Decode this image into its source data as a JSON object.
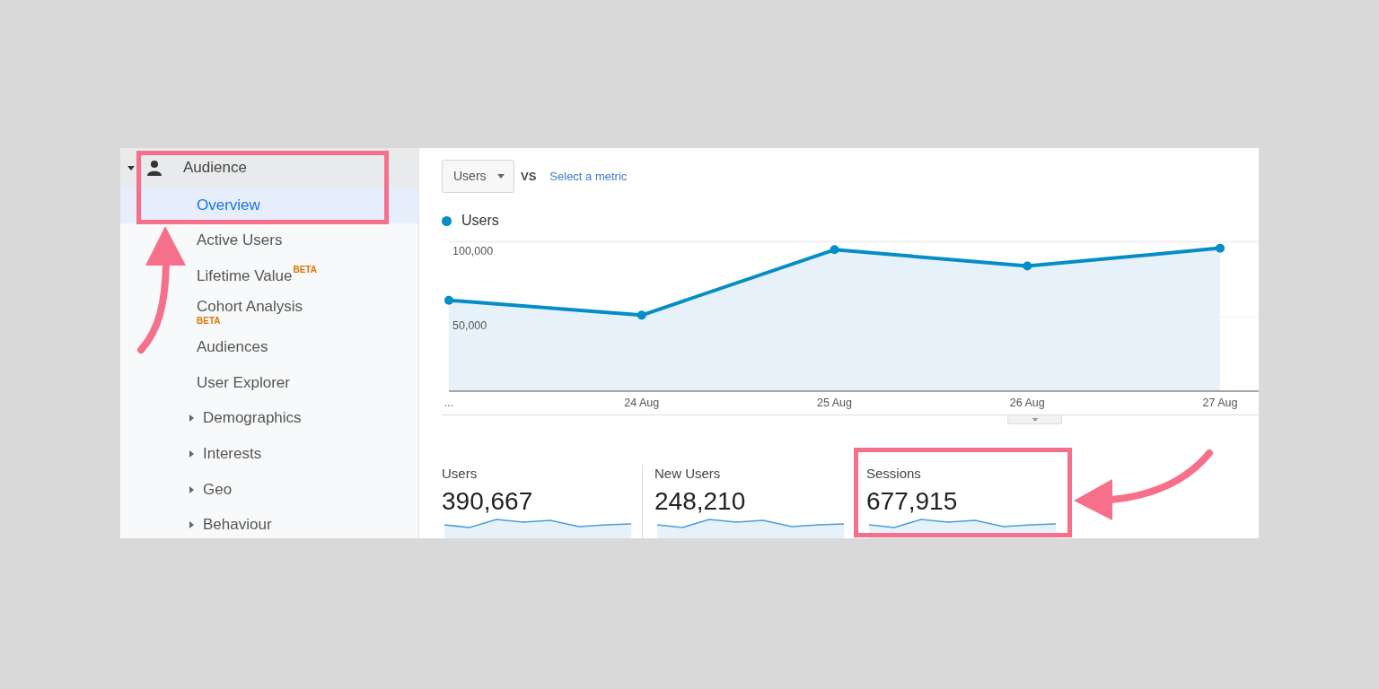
{
  "sidebar": {
    "group": {
      "label": "Audience",
      "expanded": true,
      "highlighted": true
    },
    "items": [
      {
        "label": "Overview",
        "kind": "page",
        "selected": true
      },
      {
        "label": "Active Users",
        "kind": "page",
        "selected": false
      },
      {
        "label": "Lifetime Value",
        "kind": "page",
        "selected": false,
        "badge": "BETA"
      },
      {
        "label": "Cohort Analysis",
        "kind": "stacked",
        "selected": false,
        "badge": "BETA"
      },
      {
        "label": "Audiences",
        "kind": "page",
        "selected": false
      },
      {
        "label": "User Explorer",
        "kind": "page",
        "selected": false
      },
      {
        "label": "Demographics",
        "kind": "group",
        "selected": false,
        "expanded": false
      },
      {
        "label": "Interests",
        "kind": "group",
        "selected": false,
        "expanded": false
      },
      {
        "label": "Geo",
        "kind": "group",
        "selected": false,
        "expanded": false
      },
      {
        "label": "Behaviour",
        "kind": "group",
        "selected": false,
        "expanded": false
      }
    ]
  },
  "metric_picker": {
    "metric": "Users",
    "vs": "VS",
    "link": "Select a metric"
  },
  "chart": {
    "chart_data": {
      "type": "line",
      "categories": [
        "...",
        "24 Aug",
        "25 Aug",
        "26 Aug",
        "27 Aug"
      ],
      "series": [
        {
          "name": "Users",
          "color": "#058dc7",
          "marker": "circle",
          "values": [
            61000,
            51000,
            95000,
            84000,
            96000
          ]
        }
      ],
      "ylim": [
        0,
        100000
      ],
      "yticks": [
        {
          "value": 50000,
          "label": "50,000"
        },
        {
          "value": 100000,
          "label": "100,000"
        }
      ]
    }
  },
  "scorecards": [
    {
      "label": "Users",
      "value": "390,667",
      "highlighted": false
    },
    {
      "label": "New Users",
      "value": "248,210",
      "highlighted": false
    },
    {
      "label": "Sessions",
      "value": "677,915",
      "highlighted": true
    }
  ]
}
